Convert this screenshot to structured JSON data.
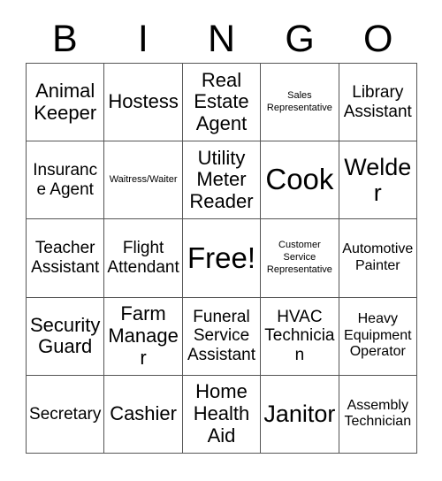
{
  "header": {
    "letters": [
      "B",
      "I",
      "N",
      "G",
      "O"
    ]
  },
  "grid": {
    "columns": 5,
    "rows": 5,
    "free_space": {
      "row": 2,
      "col": 2,
      "label": "Free!"
    },
    "cells": [
      {
        "text": "Animal Keeper",
        "size": "lg"
      },
      {
        "text": "Hostess",
        "size": "lg"
      },
      {
        "text": "Real Estate Agent",
        "size": "lg"
      },
      {
        "text": "Sales Representative",
        "size": "xs"
      },
      {
        "text": "Library Assistant",
        "size": "md"
      },
      {
        "text": "Insurance Agent",
        "size": "md"
      },
      {
        "text": "Waitress/Waiter",
        "size": "xs"
      },
      {
        "text": "Utility Meter Reader",
        "size": "lg"
      },
      {
        "text": "Cook",
        "size": "xxl"
      },
      {
        "text": "Welder",
        "size": "xl"
      },
      {
        "text": "Teacher Assistant",
        "size": "md"
      },
      {
        "text": "Flight Attendant",
        "size": "md"
      },
      {
        "text": "Free!",
        "size": "xxl"
      },
      {
        "text": "Customer Service Representative",
        "size": "xs"
      },
      {
        "text": "Automotive Painter",
        "size": "sm"
      },
      {
        "text": "Security Guard",
        "size": "lg"
      },
      {
        "text": "Farm Manager",
        "size": "lg"
      },
      {
        "text": "Funeral Service Assistant",
        "size": "md"
      },
      {
        "text": "HVAC Technician",
        "size": "md"
      },
      {
        "text": "Heavy Equipment Operator",
        "size": "sm"
      },
      {
        "text": "Secretary",
        "size": "md"
      },
      {
        "text": "Cashier",
        "size": "lg"
      },
      {
        "text": "Home Health Aid",
        "size": "lg"
      },
      {
        "text": "Janitor",
        "size": "xl"
      },
      {
        "text": "Assembly Technician",
        "size": "sm"
      }
    ]
  },
  "colors": {
    "background": "#ffffff",
    "text": "#000000",
    "grid_line": "#555555"
  }
}
